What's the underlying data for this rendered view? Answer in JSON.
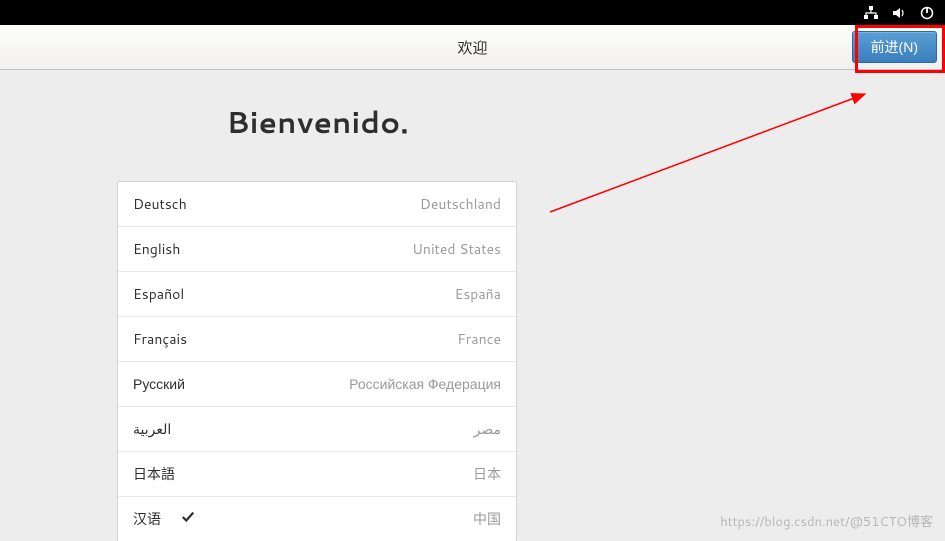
{
  "topbar": {
    "icons": [
      "network-icon",
      "volume-icon",
      "power-icon"
    ]
  },
  "header": {
    "title": "欢迎",
    "next_button_label": "前进(N)"
  },
  "welcome": {
    "heading": "Bienvenido."
  },
  "languages": [
    {
      "name": "Deutsch",
      "country": "Deutschland",
      "selected": false
    },
    {
      "name": "English",
      "country": "United States",
      "selected": false
    },
    {
      "name": "Español",
      "country": "España",
      "selected": false
    },
    {
      "name": "Français",
      "country": "France",
      "selected": false
    },
    {
      "name": "Русский",
      "country": "Российская Федерация",
      "selected": false
    },
    {
      "name": "العربية",
      "country": "مصر",
      "selected": false
    },
    {
      "name": "日本語",
      "country": "日本",
      "selected": false
    },
    {
      "name": "汉语",
      "country": "中国",
      "selected": true
    }
  ],
  "watermark": "https://blog.csdn.net/@51CTO博客"
}
